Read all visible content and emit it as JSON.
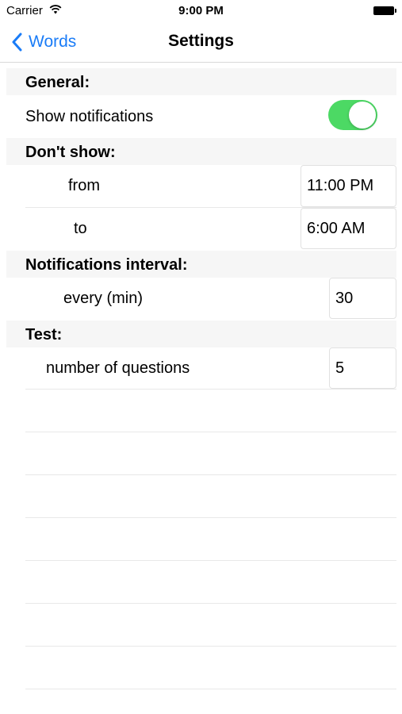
{
  "status_bar": {
    "carrier": "Carrier",
    "time": "9:00 PM"
  },
  "nav": {
    "back_label": "Words",
    "title": "Settings"
  },
  "sections": {
    "general": "General:",
    "dont_show": "Don't show:",
    "interval": "Notifications interval:",
    "test": "Test:"
  },
  "rows": {
    "show_notifications": {
      "label": "Show notifications",
      "enabled": true
    },
    "from": {
      "label": "from",
      "value": "11:00 PM"
    },
    "to": {
      "label": "to",
      "value": "6:00 AM"
    },
    "every": {
      "label": "every (min)",
      "value": "30"
    },
    "questions": {
      "label": "number of questions",
      "value": "5"
    }
  },
  "colors": {
    "accent": "#1a7cf7",
    "toggle_on": "#4cd964",
    "section_bg": "#f6f6f6"
  },
  "icons": {
    "back": "chevron-left-icon",
    "wifi": "wifi-icon",
    "battery": "battery-icon"
  }
}
